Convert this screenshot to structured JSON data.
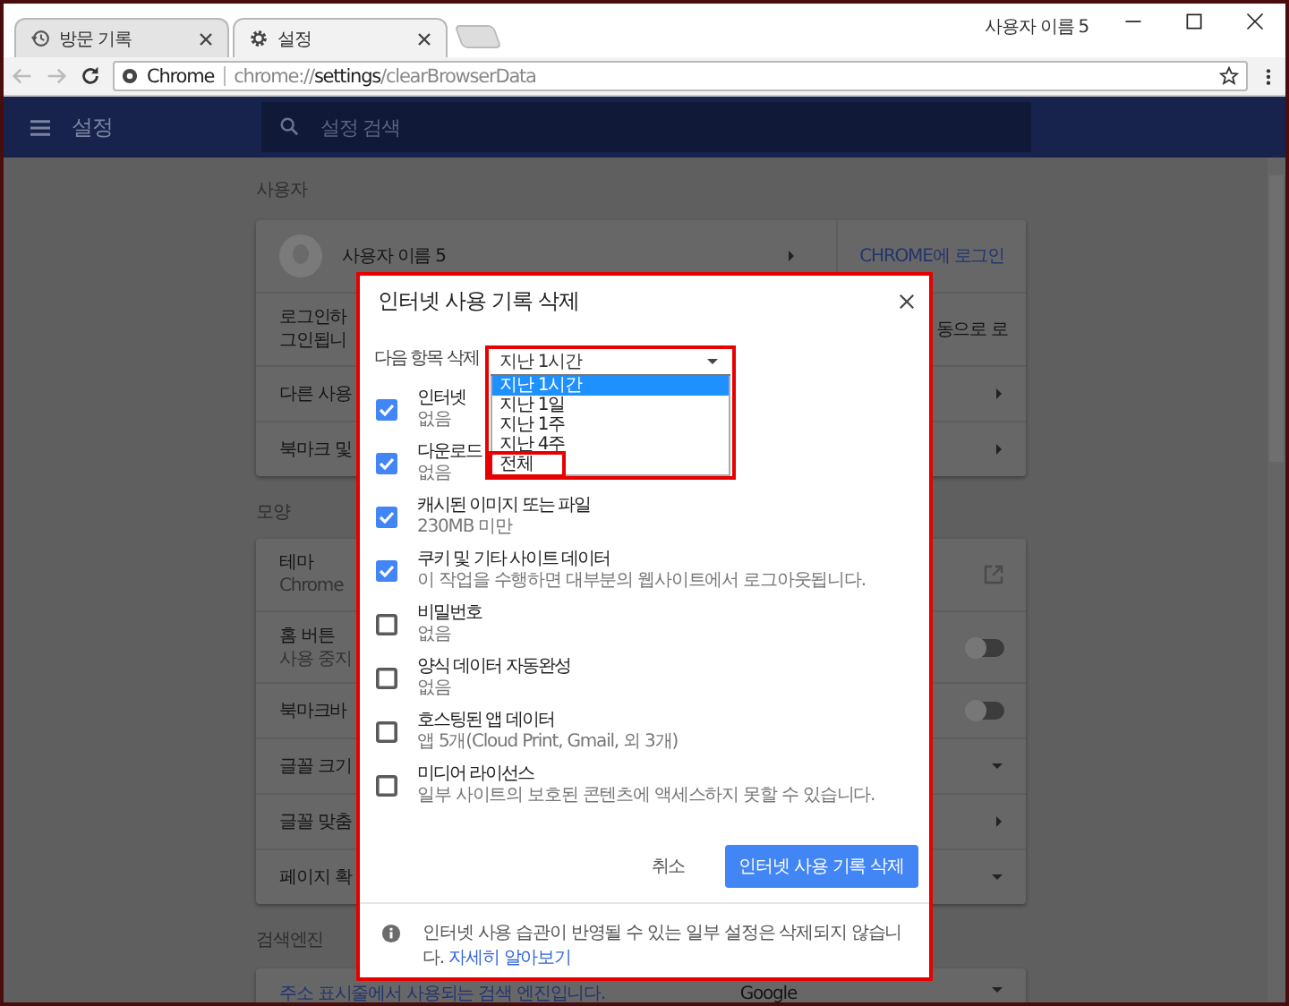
{
  "tabs": [
    {
      "label": "방문 기록",
      "kind": "history",
      "selected": false
    },
    {
      "label": "설정",
      "kind": "settings",
      "selected": true
    }
  ],
  "profile_name": "사용자 이름 5",
  "address_bar": {
    "site_label": "Chrome",
    "url_parts": [
      {
        "text": "chrome://",
        "strong": false
      },
      {
        "text": "settings",
        "strong": true
      },
      {
        "text": "/clearBrowserData",
        "strong": false
      }
    ]
  },
  "header": {
    "title": "설정",
    "search": {
      "placeholder": "설정 검색"
    }
  },
  "sections": [
    {
      "heading": "사용자",
      "rows": [
        {
          "kind": "profile",
          "label": "사용자 이름 5",
          "action": "CHROME에 로그인"
        },
        {
          "kind": "text",
          "lines": [
            "로그인하",
            "그인됩니"
          ],
          "right_text": "동으로 로"
        },
        {
          "kind": "arrow",
          "label": "다른 사용"
        },
        {
          "kind": "arrow",
          "label": "북마크 및"
        }
      ]
    },
    {
      "heading": "모양",
      "rows": [
        {
          "kind": "external",
          "label": "테마",
          "sublabel": "Chrome"
        },
        {
          "kind": "toggle",
          "label": "홈 버튼",
          "sublabel": "사용 중지",
          "on": false
        },
        {
          "kind": "toggle",
          "label": "북마크바",
          "on": false
        },
        {
          "kind": "caret",
          "label": "글꼴 크기"
        },
        {
          "kind": "arrow",
          "label": "글꼴 맞춤"
        },
        {
          "kind": "caret",
          "label": "페이지 확"
        }
      ]
    },
    {
      "heading": "검색엔진",
      "rows": [
        {
          "kind": "engine",
          "label": "주소 표시줄에서 사용되는 검색 엔진입니다.",
          "value": "Google"
        }
      ]
    }
  ],
  "dialog": {
    "title": "인터넷 사용 기록 삭제",
    "range_label": "다음 항목 삭제",
    "range_value": "지난 1시간",
    "range_options": [
      {
        "label": "지난 1시간",
        "selected": true,
        "highlighted": false
      },
      {
        "label": "지난 1일",
        "selected": false,
        "highlighted": false
      },
      {
        "label": "지난 1주",
        "selected": false,
        "highlighted": false
      },
      {
        "label": "지난 4주",
        "selected": false,
        "highlighted": false
      },
      {
        "label": "전체",
        "selected": false,
        "highlighted": true
      }
    ],
    "items": [
      {
        "label": "인터넷",
        "detail": "없음",
        "checked": true
      },
      {
        "label": "다운로드",
        "detail": "없음",
        "checked": true
      },
      {
        "label": "캐시된 이미지 또는 파일",
        "detail": "230MB 미만",
        "checked": true
      },
      {
        "label": "쿠키 및 기타 사이트 데이터",
        "detail": "이 작업을 수행하면 대부분의 웹사이트에서 로그아웃됩니다.",
        "checked": true
      },
      {
        "label": "비밀번호",
        "detail": "없음",
        "checked": false
      },
      {
        "label": "양식 데이터 자동완성",
        "detail": "없음",
        "checked": false
      },
      {
        "label": "호스팅된 앱 데이터",
        "detail": "앱 5개(Cloud Print, Gmail, 외 3개)",
        "checked": false
      },
      {
        "label": "미디어 라이선스",
        "detail": "일부 사이트의 보호된 콘텐츠에 액세스하지 못할 수 있습니다.",
        "checked": false
      }
    ],
    "buttons": [
      {
        "label": "취소",
        "kind": "text"
      },
      {
        "label": "인터넷 사용 기록 삭제",
        "kind": "primary"
      }
    ],
    "footer": {
      "text": "인터넷 사용 습관이 반영될 수 있는 일부 설정은 삭제되지 않습니다.",
      "link": "자세히 알아보기"
    }
  }
}
